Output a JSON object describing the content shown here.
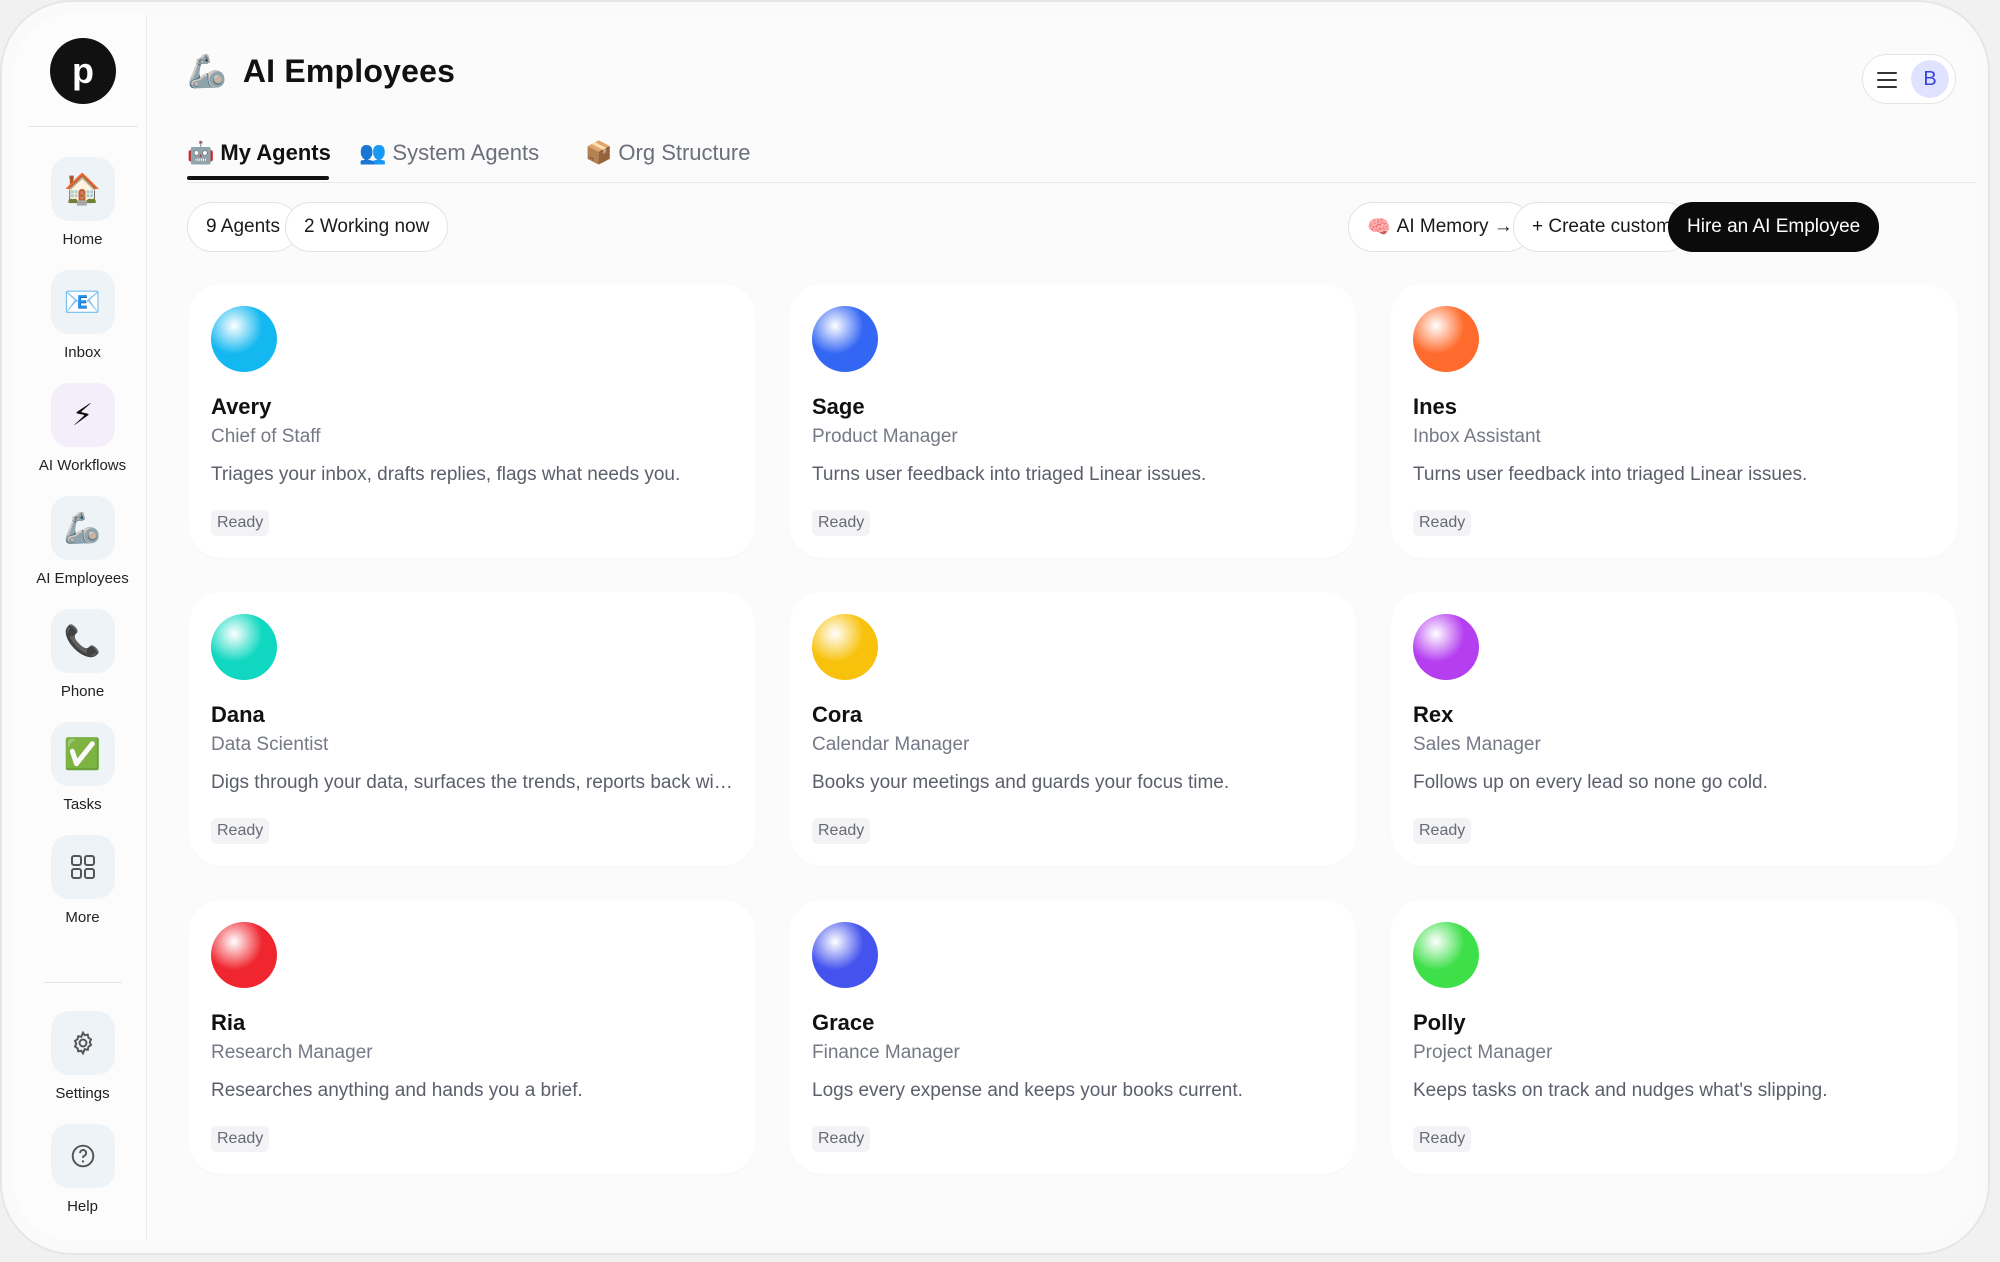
{
  "sidebar": {
    "logo": "p",
    "items": [
      {
        "label": "Home",
        "icon": "🏠",
        "name": "house-icon"
      },
      {
        "label": "Inbox",
        "icon": "📧",
        "name": "envelope-icon"
      },
      {
        "label": "AI Workflows",
        "icon": "⚡",
        "name": "lightning-icon"
      },
      {
        "label": "AI Employees",
        "icon": "🦾",
        "name": "mechanical-arm-icon"
      },
      {
        "label": "Phone",
        "icon": "📞",
        "name": "phone-icon"
      },
      {
        "label": "Tasks",
        "icon": "✅",
        "name": "checkmark-icon"
      },
      {
        "label": "More",
        "icon": "grid",
        "name": "grid-icon"
      },
      {
        "label": "Settings",
        "icon": "gear",
        "name": "gear-icon"
      },
      {
        "label": "Help",
        "icon": "?",
        "name": "help-icon"
      }
    ]
  },
  "header": {
    "title_icon": "🦾",
    "title": "AI Employees",
    "avatar": "B"
  },
  "tabs": [
    {
      "icon": "🤖",
      "label": "My Agents"
    },
    {
      "icon": "👥",
      "label": "System Agents"
    },
    {
      "icon": "📦",
      "label": "Org Structure"
    }
  ],
  "toolbar": {
    "agents_count": "9 Agents",
    "working_now": "2 Working now",
    "memory_icon": "🧠",
    "memory": "AI Memory →",
    "create": "+ Create custom",
    "hire": "Hire an AI Employee"
  },
  "agents": [
    {
      "name": "Avery",
      "role": "Chief of Staff",
      "desc": "Triages your inbox, drafts replies, flags what needs you.",
      "status": "Ready",
      "color": "#14b8f0"
    },
    {
      "name": "Sage",
      "role": "Product Manager",
      "desc": "Turns user feedback into triaged Linear issues.",
      "status": "Ready",
      "color": "#3466f4"
    },
    {
      "name": "Ines",
      "role": "Inbox Assistant",
      "desc": "Turns user feedback into triaged Linear issues.",
      "status": "Ready",
      "color": "#ff6b2c"
    },
    {
      "name": "Dana",
      "role": "Data Scientist",
      "desc": "Digs through your data, surfaces the trends, reports back with what matters.",
      "status": "Ready",
      "color": "#10d8c0"
    },
    {
      "name": "Cora",
      "role": "Calendar Manager",
      "desc": "Books your meetings and guards your focus time.",
      "status": "Ready",
      "color": "#f8c20c"
    },
    {
      "name": "Rex",
      "role": "Sales Manager",
      "desc": "Follows up on every lead so none go cold.",
      "status": "Ready",
      "color": "#b53ef0"
    },
    {
      "name": "Ria",
      "role": "Research Manager",
      "desc": "Researches anything and hands you a brief.",
      "status": "Ready",
      "color": "#f0262f"
    },
    {
      "name": "Grace",
      "role": "Finance Manager",
      "desc": "Logs every expense and keeps your books current.",
      "status": "Ready",
      "color": "#4553ee"
    },
    {
      "name": "Polly",
      "role": "Project Manager",
      "desc": "Keeps tasks on track and nudges what's slipping.",
      "status": "Ready",
      "color": "#3ee04a"
    }
  ]
}
